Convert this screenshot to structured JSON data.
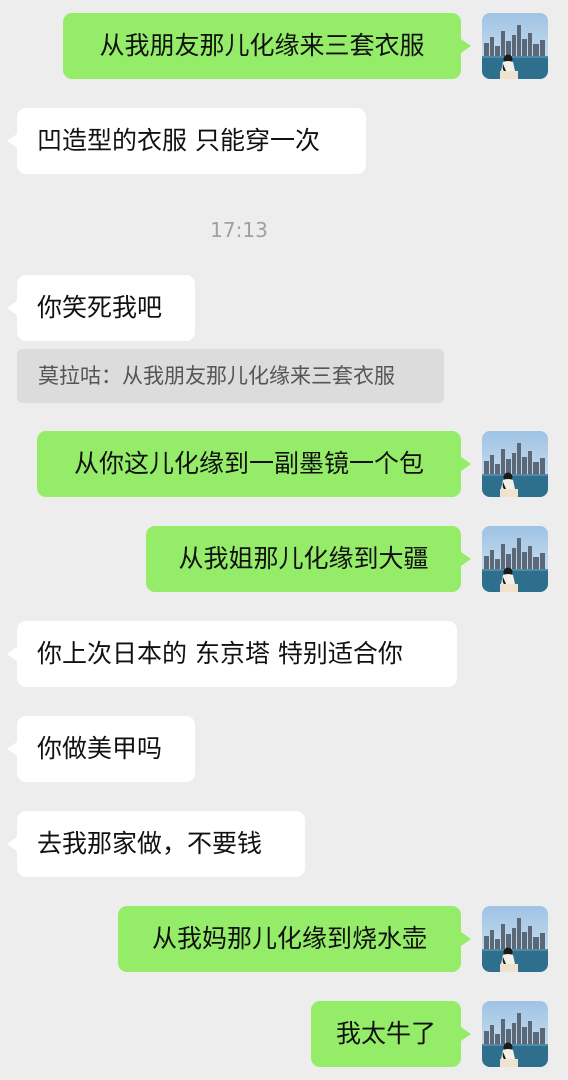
{
  "messages": [
    {
      "text": "从我朋友那儿化缘来三套衣服"
    },
    {
      "text": "凹造型的衣服 只能穿一次"
    },
    {
      "text": "你笑死我吧"
    },
    {
      "text": "从你这儿化缘到一副墨镜一个包"
    },
    {
      "text": "从我姐那儿化缘到大疆"
    },
    {
      "text": "你上次日本的 东京塔 特别适合你"
    },
    {
      "text": "你做美甲吗"
    },
    {
      "text": "去我那家做，不要钱"
    },
    {
      "text": "从我妈那儿化缘到烧水壶"
    },
    {
      "text": "我太牛了"
    }
  ],
  "timestamp": "17:13",
  "quote": {
    "text": "莫拉咕：从我朋友那儿化缘来三套衣服"
  },
  "colors": {
    "background": "#ededed",
    "outgoing_bubble": "#95ec69",
    "incoming_bubble": "#ffffff",
    "quote_bg": "#dcdcdc"
  },
  "avatar": {
    "icon": "city-skyline-avatar"
  }
}
